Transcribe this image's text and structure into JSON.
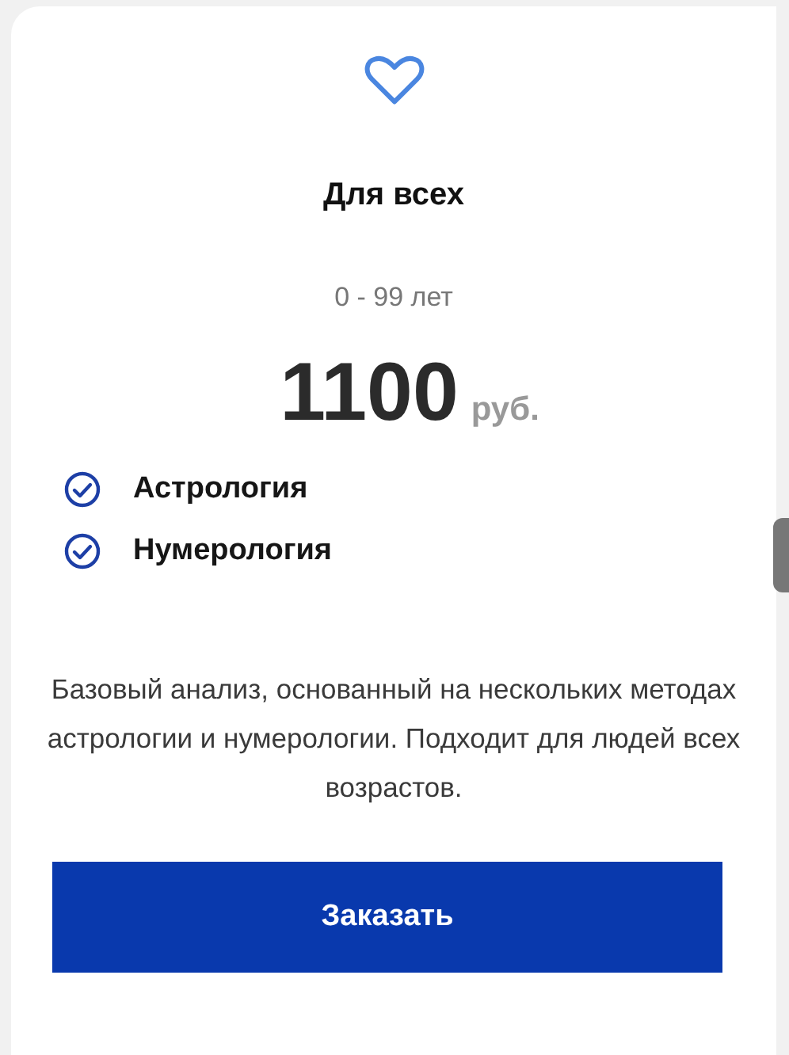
{
  "plan": {
    "title": "Для всех",
    "age_range": "0 - 99 лет",
    "price": "1100",
    "currency": "руб."
  },
  "features": [
    {
      "label": "Астрология"
    },
    {
      "label": "Нумерология"
    }
  ],
  "description": "Базовый анализ, основанный на нескольких методах астрологии и нумерологии. Подходит для людей всех возрастов.",
  "button": "Заказать"
}
